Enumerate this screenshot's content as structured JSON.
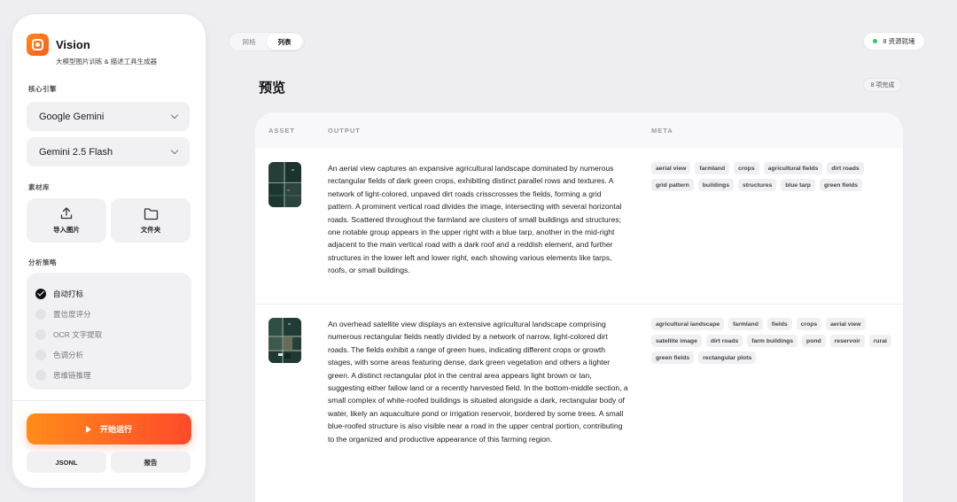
{
  "sidebar": {
    "brand": {
      "name": "Vision",
      "subtitle": "大模型图片训练 & 描述工具生成器"
    },
    "engine_label": "核心引擎",
    "provider_select": "Google Gemini",
    "model_select": "Gemini 2.5 Flash",
    "library_label": "素材库",
    "import_label": "导入图片",
    "folder_label": "文件夹",
    "strategy_label": "分析策略",
    "options": [
      {
        "label": "自动打标",
        "checked": true
      },
      {
        "label": "置信度评分",
        "checked": false
      },
      {
        "label": "OCR 文字提取",
        "checked": false
      },
      {
        "label": "色调分析",
        "checked": false
      },
      {
        "label": "思维链推理",
        "checked": false
      }
    ],
    "run_label": "开始运行",
    "jsonl_label": "JSONL",
    "report_label": "报告"
  },
  "topbar": {
    "view_tabs": [
      "网格",
      "列表"
    ],
    "active_tab": "列表",
    "status": "8 资源就绪"
  },
  "main": {
    "title": "预览",
    "count_badge": "8 项完成",
    "columns": [
      "ASSET",
      "OUTPUT",
      "META"
    ],
    "rows": [
      {
        "output": "An aerial view captures an expansive agricultural landscape dominated by numerous rectangular fields of dark green crops, exhibiting distinct parallel rows and textures. A network of light-colored, unpaved dirt roads crisscrosses the fields, forming a grid pattern. A prominent vertical road divides the image, intersecting with several horizontal roads. Scattered throughout the farmland are clusters of small buildings and structures; one notable group appears in the upper right with a blue tarp, another in the mid-right adjacent to the main vertical road with a dark roof and a reddish element, and further structures in the lower left and lower right, each showing various elements like tarps, roofs, or small buildings.",
        "tags": [
          "aerial view",
          "farmland",
          "crops",
          "agricultural fields",
          "dirt roads",
          "grid pattern",
          "buildings",
          "structures",
          "blue tarp",
          "green fields"
        ]
      },
      {
        "output": "An overhead satellite view displays an extensive agricultural landscape comprising numerous rectangular fields neatly divided by a network of narrow, light-colored dirt roads. The fields exhibit a range of green hues, indicating different crops or growth stages, with some areas featuring dense, dark green vegetation and others a lighter green. A distinct rectangular plot in the central area appears light brown or tan, suggesting either fallow land or a recently harvested field. In the bottom-middle section, a small complex of white-roofed buildings is situated alongside a dark, rectangular body of water, likely an aquaculture pond or irrigation reservoir, bordered by some trees. A small blue-roofed structure is also visible near a road in the upper central portion, contributing to the organized and productive appearance of this farming region.",
        "tags": [
          "agricultural landscape",
          "farmland",
          "fields",
          "crops",
          "aerial view",
          "satellite image",
          "dirt roads",
          "farm buildings",
          "pond",
          "reservoir",
          "rural",
          "green fields",
          "rectangular plots"
        ]
      }
    ]
  },
  "colors": {
    "accent_start": "#ff8c1a",
    "accent_end": "#ff4a2a",
    "status_dot": "#34c759"
  }
}
